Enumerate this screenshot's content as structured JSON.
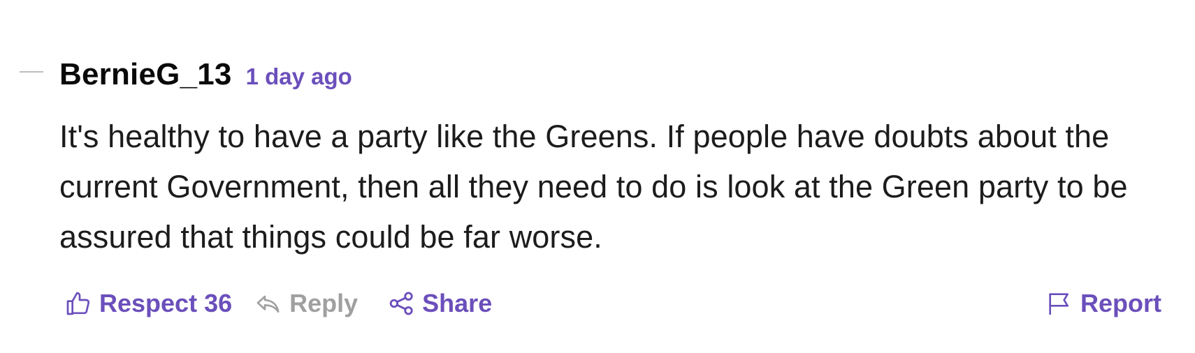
{
  "comment": {
    "username": "BernieG_13",
    "timestamp": "1 day ago",
    "body": "It's healthy to have a party like the Greens. If people have doubts about the current Government, then all they need to do is look at the Green party to be assured that things could be far worse."
  },
  "actions": {
    "respect_label": "Respect 36",
    "reply_label": "Reply",
    "share_label": "Share",
    "report_label": "Report"
  },
  "icons": {
    "collapse": "collapse-line-icon",
    "respect": "thumbs-up-icon",
    "reply": "reply-arrow-icon",
    "share": "share-nodes-icon",
    "report": "flag-icon"
  },
  "colors": {
    "accent": "#6b4fbb",
    "muted": "#a0a0a0",
    "text": "#1c1c1c",
    "background": "#ffffff"
  }
}
